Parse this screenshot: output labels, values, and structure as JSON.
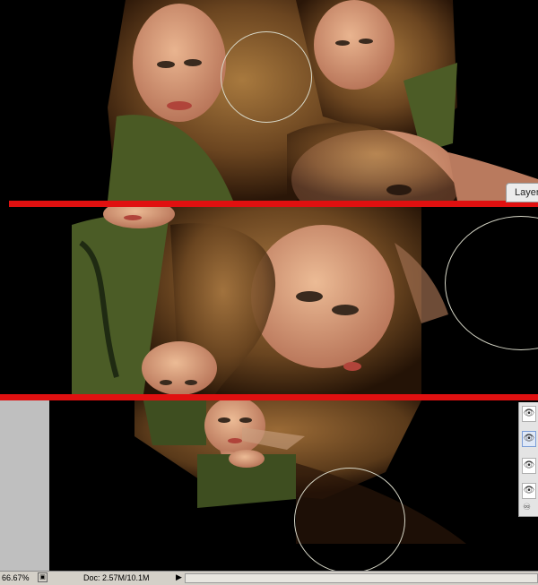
{
  "canvas": {
    "image": "photo-collage-woman-hair",
    "separator_color": "#e01010",
    "background": "#000000"
  },
  "layers_panel": {
    "tab_label": "Layer"
  },
  "status": {
    "zoom": "66.67%",
    "doc": "Doc: 2.57M/10.1M"
  }
}
